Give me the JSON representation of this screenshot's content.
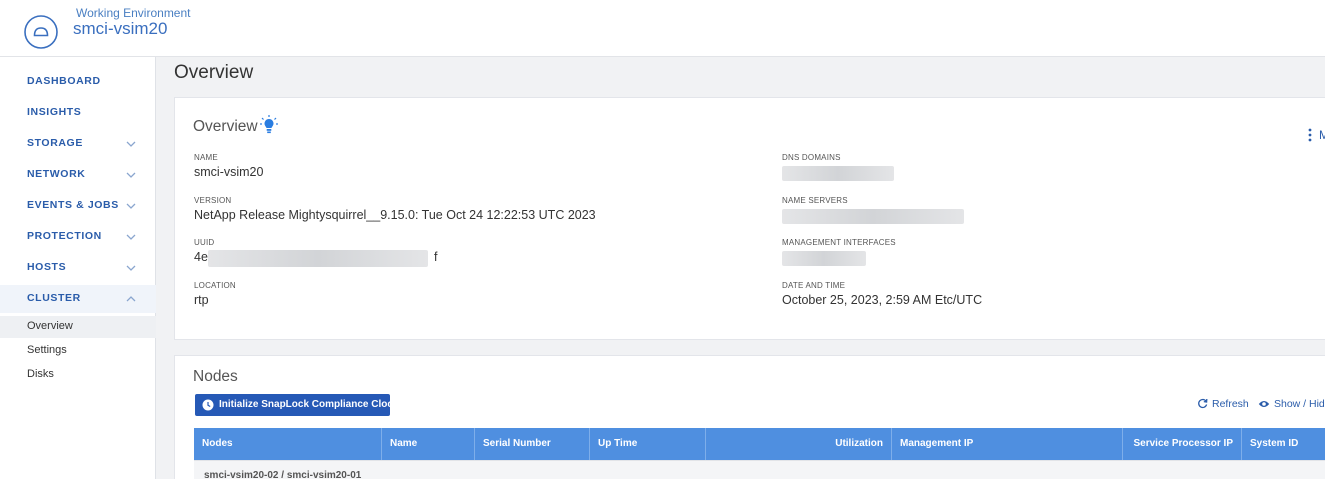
{
  "header": {
    "env_label": "Working Environment",
    "env_name": "smci-vsim20"
  },
  "sidebar": {
    "items": [
      {
        "label": "DASHBOARD",
        "chevron": "none"
      },
      {
        "label": "INSIGHTS",
        "chevron": "none"
      },
      {
        "label": "STORAGE",
        "chevron": "chevron-down"
      },
      {
        "label": "NETWORK",
        "chevron": "chevron-down"
      },
      {
        "label": "EVENTS & JOBS",
        "chevron": "chevron-down"
      },
      {
        "label": "PROTECTION",
        "chevron": "chevron-down"
      },
      {
        "label": "HOSTS",
        "chevron": "chevron-down"
      },
      {
        "label": "CLUSTER",
        "chevron": "chevron-up"
      }
    ],
    "cluster_subitems": [
      {
        "label": "Overview",
        "active": true
      },
      {
        "label": "Settings",
        "active": false
      },
      {
        "label": "Disks",
        "active": false
      }
    ]
  },
  "page": {
    "title": "Overview"
  },
  "overview": {
    "title": "Overview",
    "more_label": "M",
    "name_label": "NAME",
    "name_value": "smci-vsim20",
    "version_label": "VERSION",
    "version_value": "NetApp Release Mightysquirrel__9.15.0: Tue Oct 24 12:22:53 UTC 2023",
    "uuid_label": "UUID",
    "uuid_prefix": "4e7",
    "uuid_suffix": "f",
    "location_label": "LOCATION",
    "location_value": "rtp",
    "dns_label": "DNS DOMAINS",
    "nameservers_label": "NAME SERVERS",
    "mgmt_label": "MANAGEMENT INTERFACES",
    "datetime_label": "DATE AND TIME",
    "datetime_value": "October 25, 2023, 2:59 AM  Etc/UTC"
  },
  "nodes": {
    "title": "Nodes",
    "init_button": "Initialize SnapLock Compliance Clock",
    "refresh": "Refresh",
    "show_hide": "Show / Hide",
    "columns": [
      "Nodes",
      "Name",
      "Serial Number",
      "Up Time",
      "Utilization",
      "Management IP",
      "Service Processor IP",
      "System ID"
    ],
    "rows": [
      {
        "nodes": "smci-vsim20-02 / smci-vsim20-01"
      }
    ]
  },
  "colors": {
    "accent": "#2a5caa",
    "table_header": "#4f8fe0",
    "button": "#2659b6"
  }
}
